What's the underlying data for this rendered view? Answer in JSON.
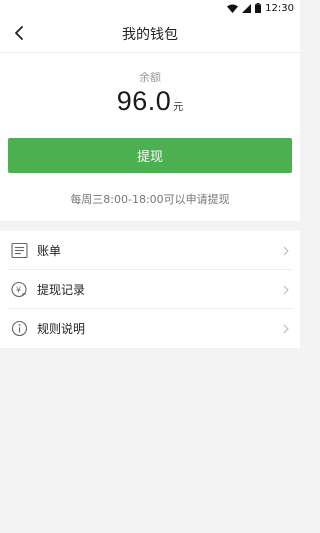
{
  "status_bar": {
    "time": "12:30",
    "icons": [
      "wifi-icon",
      "signal-icon",
      "battery-icon"
    ]
  },
  "nav": {
    "title": "我的钱包",
    "back_icon": "back-arrow-icon"
  },
  "balance": {
    "label": "余额",
    "value": "96.0",
    "unit": "元"
  },
  "withdraw": {
    "button_label": "提现",
    "hint": "每周三8:00-18:00可以申请提现",
    "accent_color": "#4caf50"
  },
  "menu": {
    "items": [
      {
        "label": "账单",
        "icon": "bill-icon"
      },
      {
        "label": "提现记录",
        "icon": "withdraw-record-icon"
      },
      {
        "label": "规则说明",
        "icon": "info-icon"
      }
    ]
  }
}
